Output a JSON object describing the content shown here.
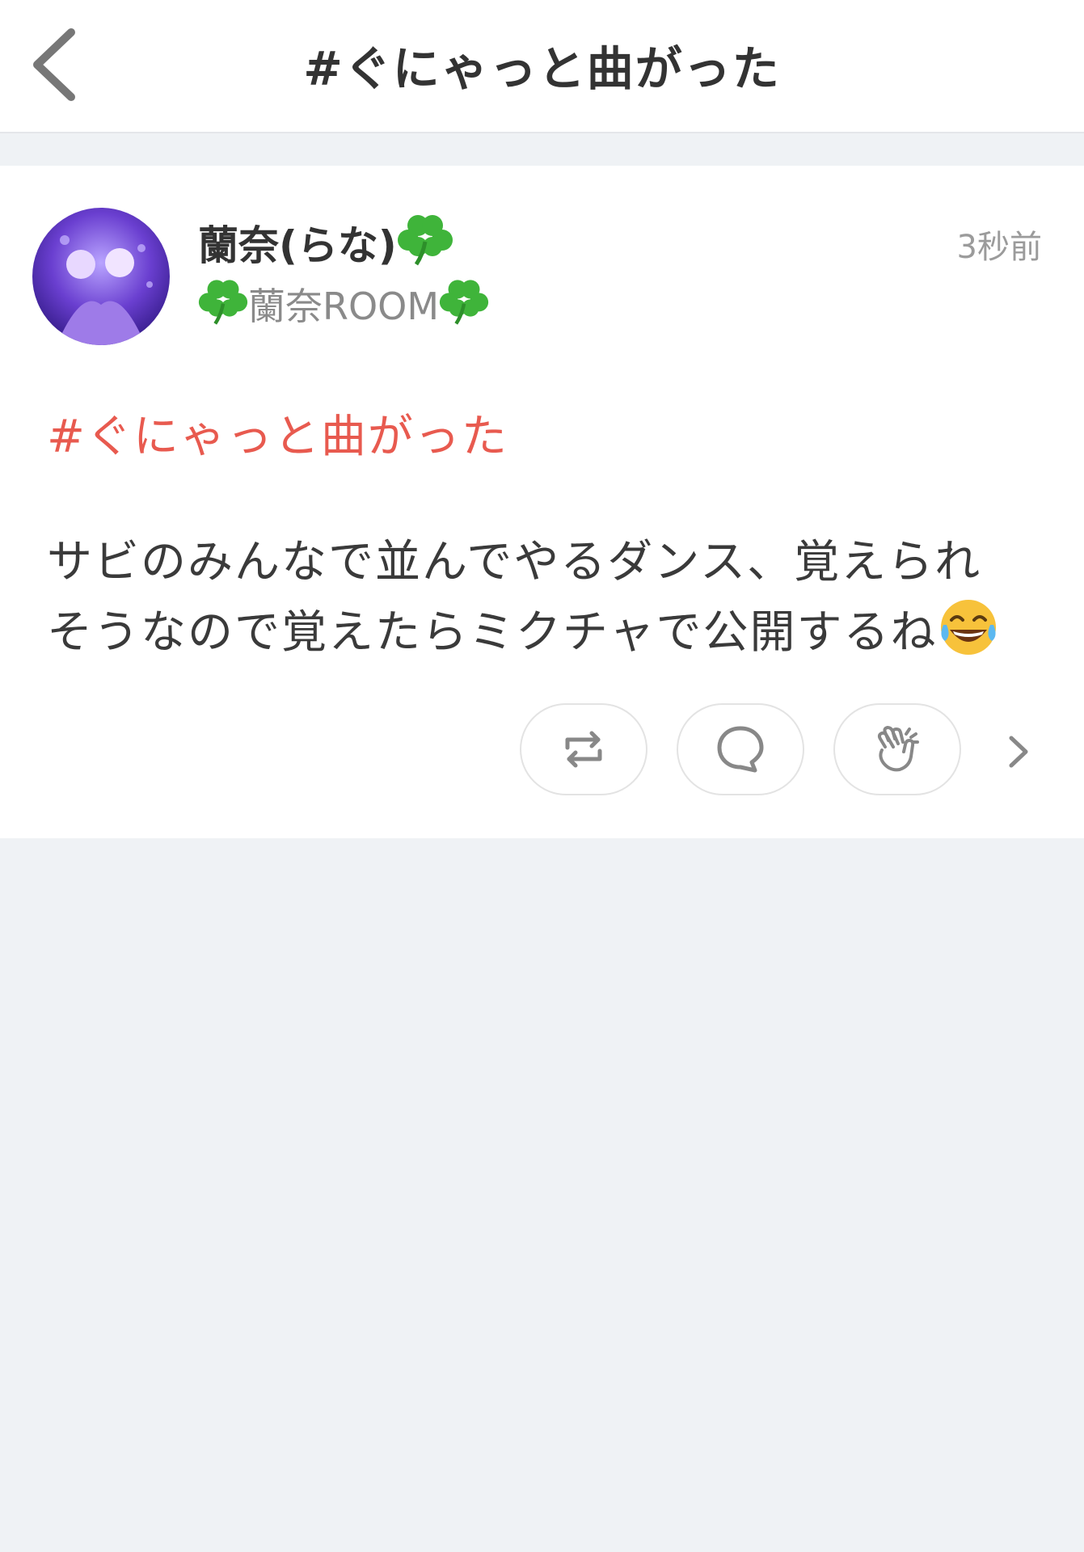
{
  "header": {
    "title": "#ぐにゃっと曲がった",
    "back_icon": "chevron-left-icon"
  },
  "post": {
    "user_name": "蘭奈(らな)",
    "room_name": "蘭奈ROOM",
    "timestamp": "3秒前",
    "hashtag": "#ぐにゃっと曲がった",
    "body_line1": "サビのみんなで並んでやるダンス、覚えられ",
    "body_line2": "そうなので覚えたらミクチャで公開するね",
    "actions": {
      "repost_icon": "repost-icon",
      "comment_icon": "comment-icon",
      "clap_icon": "clap-icon",
      "more_icon": "chevron-right-icon"
    }
  },
  "colors": {
    "hashtag": "#e85a4f",
    "background": "#eff2f5",
    "clover": "#3fb43a",
    "avatar": "#6a3fd0"
  }
}
